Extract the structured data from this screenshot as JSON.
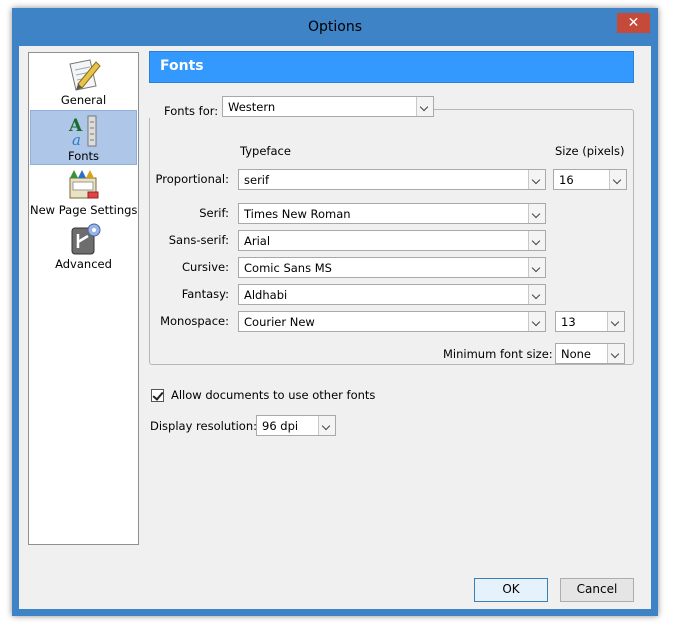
{
  "window": {
    "title": "Options",
    "close_glyph": "✕"
  },
  "sidebar": {
    "items": [
      {
        "label": "General",
        "icon": "pencil-paper-icon",
        "selected": false
      },
      {
        "label": "Fonts",
        "icon": "fonts-icon",
        "selected": true
      },
      {
        "label": "New Page Settings",
        "icon": "new-page-settings-icon",
        "selected": false
      },
      {
        "label": "Advanced",
        "icon": "advanced-gear-icon",
        "selected": false
      }
    ]
  },
  "panel": {
    "title": "Fonts",
    "fonts_for": {
      "label": "Fonts for:",
      "value": "Western"
    },
    "headers": {
      "typeface": "Typeface",
      "size": "Size (pixels)"
    },
    "rows": [
      {
        "label": "Proportional:",
        "value": "serif"
      },
      {
        "label": "Serif:",
        "value": "Times New Roman"
      },
      {
        "label": "Sans-serif:",
        "value": "Arial"
      },
      {
        "label": "Cursive:",
        "value": "Comic Sans MS"
      },
      {
        "label": "Fantasy:",
        "value": "Aldhabi"
      },
      {
        "label": "Monospace:",
        "value": "Courier New"
      }
    ],
    "proportional_size": "16",
    "monospace_size": "13",
    "min_font_size": {
      "label": "Minimum font size:",
      "value": "None"
    },
    "allow_fonts": {
      "label": "Allow documents to use other fonts",
      "checked": true
    },
    "display_resolution": {
      "label": "Display resolution:",
      "value": "96 dpi"
    }
  },
  "buttons": {
    "ok": "OK",
    "cancel": "Cancel"
  },
  "colors": {
    "titlebar": "#3d83c6",
    "banner": "#3399ff",
    "selected": "#aec6e8",
    "close": "#c64a3a"
  }
}
